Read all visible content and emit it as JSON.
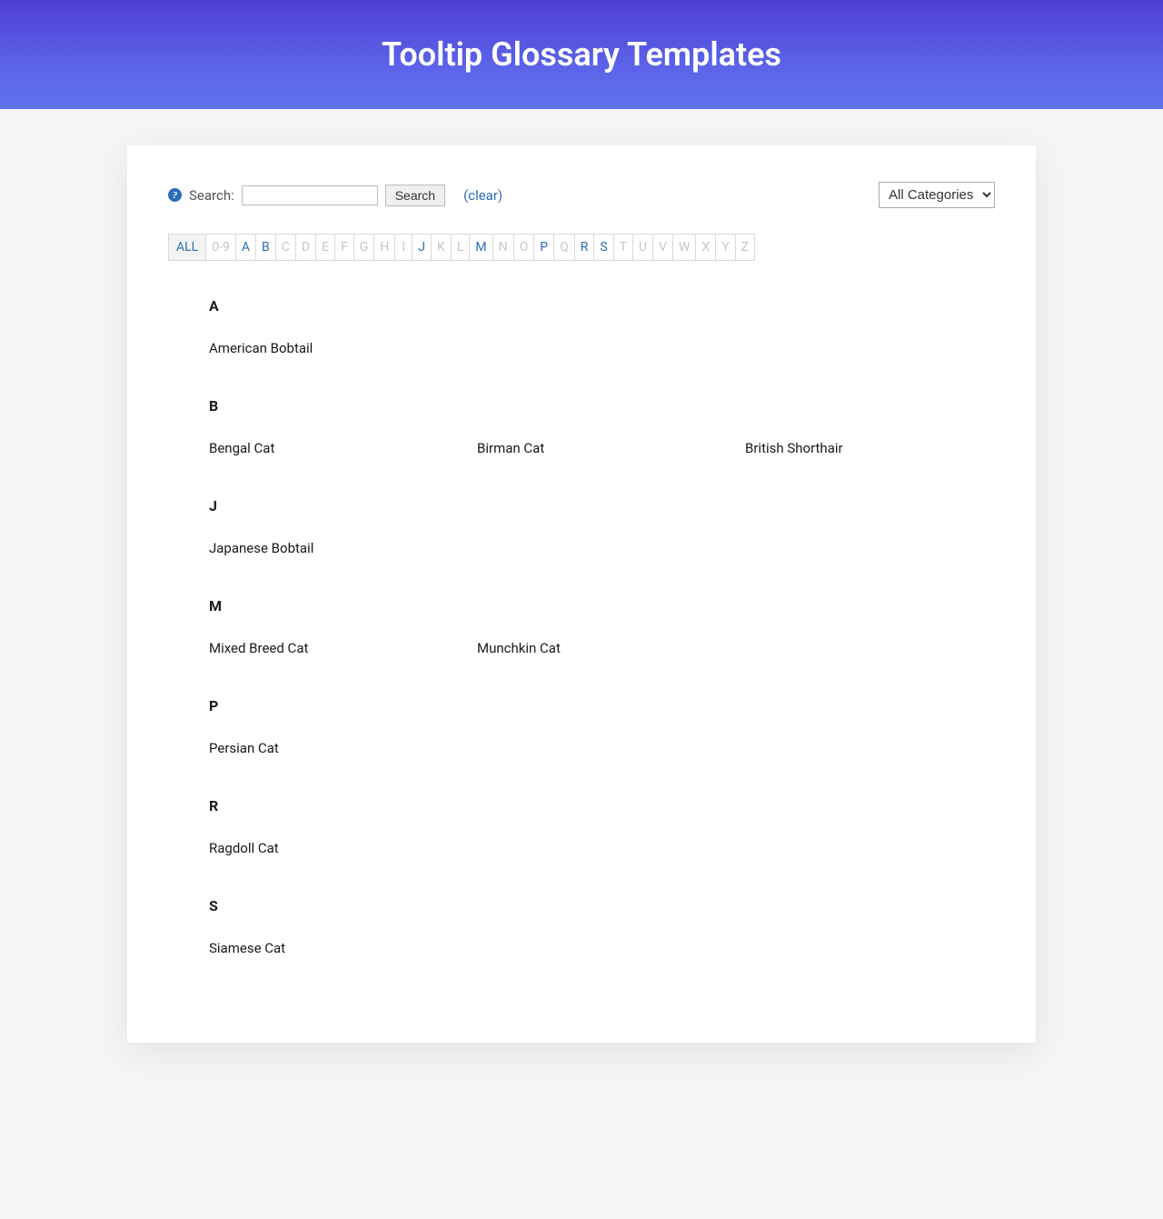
{
  "hero": {
    "title": "Tooltip Glossary Templates"
  },
  "toolbar": {
    "help_glyph": "?",
    "search_label": "Search:",
    "search_value": "",
    "search_button": "Search",
    "clear_label": "(clear)",
    "category_selected": "All Categories"
  },
  "alpha_nav": [
    {
      "label": "ALL",
      "state": "active"
    },
    {
      "label": "0-9",
      "state": "disabled"
    },
    {
      "label": "A",
      "state": "link"
    },
    {
      "label": "B",
      "state": "link"
    },
    {
      "label": "C",
      "state": "disabled"
    },
    {
      "label": "D",
      "state": "disabled"
    },
    {
      "label": "E",
      "state": "disabled"
    },
    {
      "label": "F",
      "state": "disabled"
    },
    {
      "label": "G",
      "state": "disabled"
    },
    {
      "label": "H",
      "state": "disabled"
    },
    {
      "label": "I",
      "state": "disabled"
    },
    {
      "label": "J",
      "state": "link"
    },
    {
      "label": "K",
      "state": "disabled"
    },
    {
      "label": "L",
      "state": "disabled"
    },
    {
      "label": "M",
      "state": "link"
    },
    {
      "label": "N",
      "state": "disabled"
    },
    {
      "label": "O",
      "state": "disabled"
    },
    {
      "label": "P",
      "state": "link"
    },
    {
      "label": "Q",
      "state": "disabled"
    },
    {
      "label": "R",
      "state": "link"
    },
    {
      "label": "S",
      "state": "link"
    },
    {
      "label": "T",
      "state": "disabled"
    },
    {
      "label": "U",
      "state": "disabled"
    },
    {
      "label": "V",
      "state": "disabled"
    },
    {
      "label": "W",
      "state": "disabled"
    },
    {
      "label": "X",
      "state": "disabled"
    },
    {
      "label": "Y",
      "state": "disabled"
    },
    {
      "label": "Z",
      "state": "disabled"
    }
  ],
  "sections": [
    {
      "letter": "A",
      "terms": [
        "American Bobtail"
      ]
    },
    {
      "letter": "B",
      "terms": [
        "Bengal Cat",
        "Birman Cat",
        "British Shorthair"
      ]
    },
    {
      "letter": "J",
      "terms": [
        "Japanese Bobtail"
      ]
    },
    {
      "letter": "M",
      "terms": [
        "Mixed Breed Cat",
        "Munchkin Cat"
      ]
    },
    {
      "letter": "P",
      "terms": [
        "Persian Cat"
      ]
    },
    {
      "letter": "R",
      "terms": [
        "Ragdoll Cat"
      ]
    },
    {
      "letter": "S",
      "terms": [
        "Siamese Cat"
      ]
    }
  ]
}
